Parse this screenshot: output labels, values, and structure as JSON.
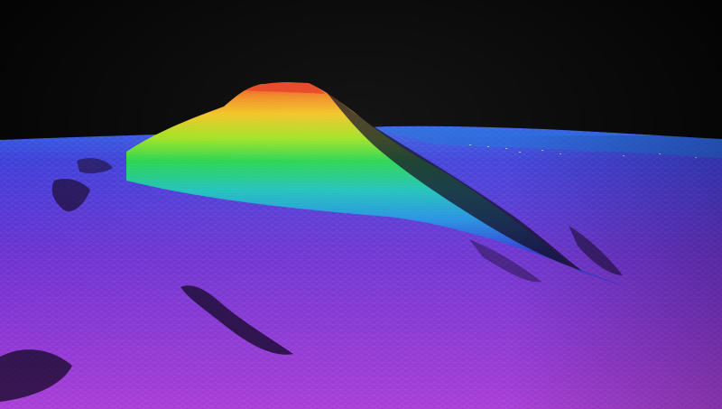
{
  "scene": {
    "subject": "seamount",
    "colors": {
      "sky": "#000000",
      "summit": "#e8401c",
      "upper_slope": "#f2c21a",
      "mid_slope": "#1fd34a",
      "lower_slope": "#18b6d8",
      "base": "#2a3ad6",
      "seafloor": "#7a2fd0",
      "foreground": "#b043d8",
      "shadow": "#14062a"
    }
  }
}
